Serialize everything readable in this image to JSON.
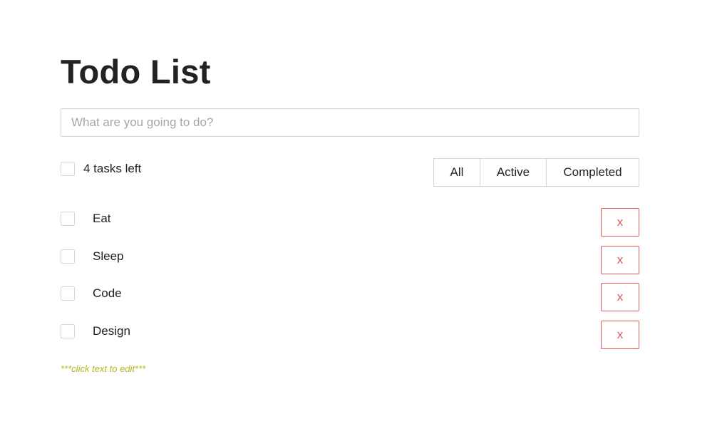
{
  "header": {
    "title": "Todo List"
  },
  "new_todo": {
    "placeholder": "What are you going to do?",
    "value": ""
  },
  "summary": {
    "tasks_left": "4 tasks left"
  },
  "filters": {
    "all": "All",
    "active": "Active",
    "completed": "Completed"
  },
  "todos": [
    {
      "text": "Eat",
      "completed": false,
      "delete_label": "x"
    },
    {
      "text": "Sleep",
      "completed": false,
      "delete_label": "x"
    },
    {
      "text": "Code",
      "completed": false,
      "delete_label": "x"
    },
    {
      "text": "Design",
      "completed": false,
      "delete_label": "x"
    }
  ],
  "hint": "***click text to edit***",
  "colors": {
    "delete": "#e05a5a",
    "hint": "#b5b51e",
    "border": "#d4d4d4"
  }
}
